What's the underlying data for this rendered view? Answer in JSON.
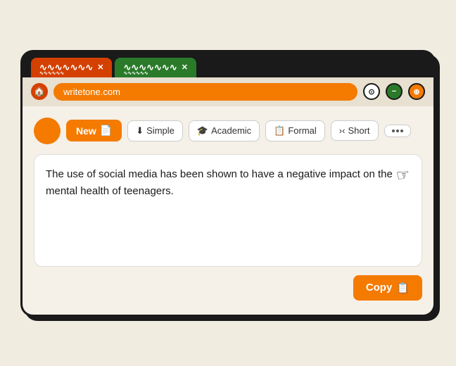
{
  "browser": {
    "tabs": [
      {
        "id": "tab1",
        "label": "∿∿∿∿∿∿∿",
        "active": true,
        "color": "#d44000"
      },
      {
        "id": "tab2",
        "label": "∿∿∿∿∿∿∿",
        "active": false,
        "color": "#2a7a2a"
      }
    ],
    "close_label": "✕",
    "address": "writetone.com",
    "home_icon": "🏠",
    "nav_buttons": [
      "⊙",
      "−",
      "⊕"
    ]
  },
  "toolbar": {
    "new_label": "New",
    "new_icon": "📄",
    "filters": [
      {
        "id": "simple",
        "icon": "⬇",
        "label": "Simple"
      },
      {
        "id": "academic",
        "icon": "🎓",
        "label": "Academic"
      },
      {
        "id": "formal",
        "icon": "📋",
        "label": "Formal"
      },
      {
        "id": "short",
        "icon": ">‹",
        "label": "Short"
      }
    ],
    "more_dots": "···"
  },
  "textarea": {
    "content": "The use of social media has been shown to have a negative impact on the mental health of teenagers."
  },
  "actions": {
    "copy_label": "Copy",
    "copy_icon": "📋"
  },
  "colors": {
    "orange": "#f47a00",
    "dark_orange": "#d44000",
    "green": "#2a7a2a",
    "text": "#1a1a1a",
    "bg": "#f5f0e8"
  }
}
